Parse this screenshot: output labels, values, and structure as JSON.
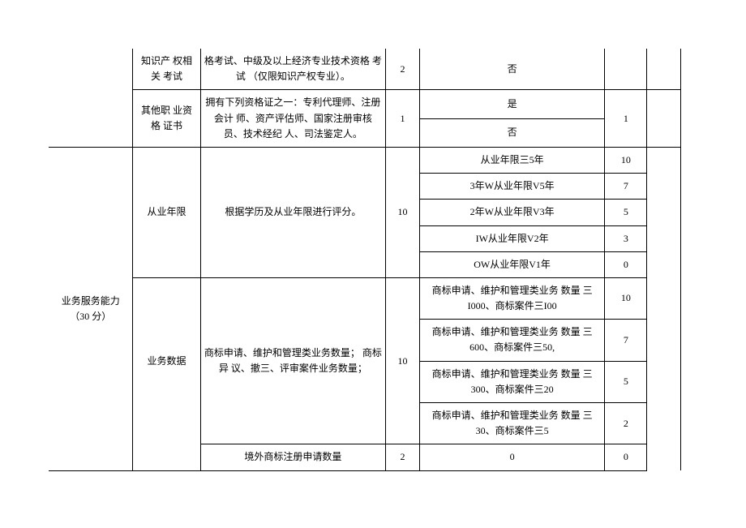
{
  "rows": {
    "r1": {
      "sub": "知识产 权相 关 考试",
      "desc": "格考试、中级及以上经济专业技术资格 考试 （仅限知识产权专业）。",
      "s1": "2",
      "detail": "否"
    },
    "r2": {
      "sub": "其他职 业资 格 证书",
      "desc": "拥有下列资格证之一：专利代理师、注册 会计 师、资产评估师、国家注册审核 员、技术经纪 人、司法鉴定人。",
      "s1": "1",
      "detail_a": "是",
      "detail_b": "否",
      "s2": "1"
    },
    "cat": {
      "label": "业务服务能力 （30 分）"
    },
    "r3": {
      "sub": "从业年限",
      "desc": "根据学历及从业年限进行评分。",
      "s1": "10",
      "d1": "从业年限三5年",
      "v1": "10",
      "d2": "3年W从业年限V5年",
      "v2": "7",
      "d3": "2年W从业年限V3年",
      "v3": "5",
      "d4": "IW从业年限V2年",
      "v4": "3",
      "d5": "OW从业年限V1年",
      "v5": "0"
    },
    "r4": {
      "sub": "业务数据",
      "desc": "商标申请、维护和管理类业务数量； 商标异 议、撤三、评审案件业务数量；",
      "s1": "10",
      "d1": "商标申请、维护和管理类业务 数量 三I000、商标案件三I00",
      "v1": "10",
      "d2": "商标申请、维护和管理类业务 数量 三600、商标案件三50,",
      "v2": "7",
      "d3": "商标申请、维护和管理类业务 数量 三300、商标案件三20",
      "v3": "5",
      "d4": "商标申请、维护和管理类业务 数量 三30、商标案件三5",
      "v4": "2"
    },
    "r5": {
      "desc": "境外商标注册申请数量",
      "s1": "2",
      "detail": "0",
      "v": "0"
    }
  }
}
